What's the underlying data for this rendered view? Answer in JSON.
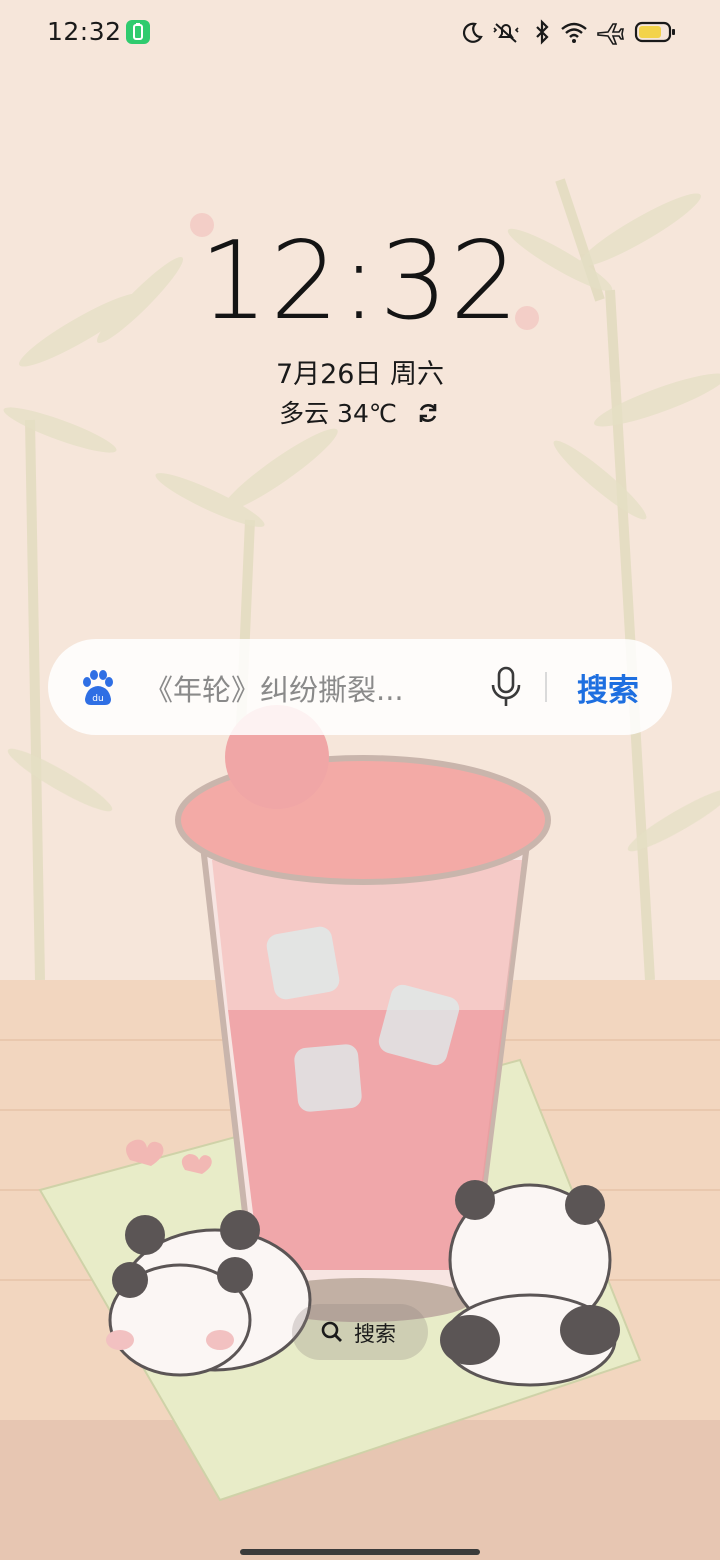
{
  "status_bar": {
    "time": "12:32",
    "icons": [
      "battery-saver-icon",
      "moon-icon",
      "mute-icon",
      "bluetooth-icon",
      "wifi-icon",
      "airplane-icon",
      "battery-icon"
    ]
  },
  "lockscreen": {
    "clock": "12:32",
    "date": "7月26日 周六",
    "weather": "多云 34℃"
  },
  "search_widget": {
    "placeholder": "《年轮》纠纷撕裂...",
    "button_label": "搜索"
  },
  "bottom_search": {
    "label": "搜索"
  },
  "colors": {
    "accent": "#1e6fe0",
    "notification_badge": "#2fcb6e"
  }
}
